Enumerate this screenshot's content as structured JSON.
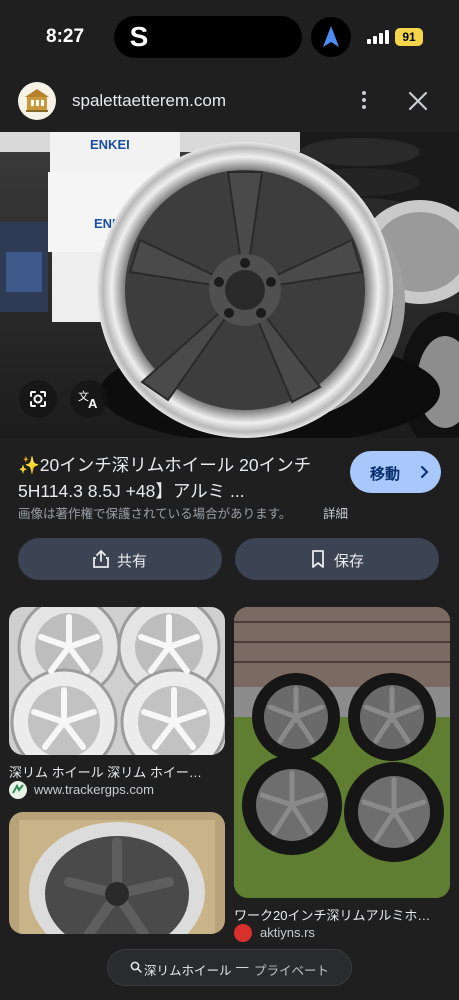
{
  "status_bar": {
    "time": "8:27",
    "app_letter": "S",
    "battery": "91"
  },
  "header": {
    "site": "spalettaetterem.com"
  },
  "hero": {
    "brand_text": "ENKEI"
  },
  "result": {
    "title": "✨20インチ深リムホイール 20インチ 5H114.3 8.5J +48】アルミ ...",
    "visit_label": "移動",
    "copyright_notice": "画像は著作権で保護されている場合があります。",
    "copyright_detail": "詳細"
  },
  "actions": {
    "share_label": "共有",
    "save_label": "保存"
  },
  "related": [
    {
      "title": "深リム ホイール 深リム ホイー…",
      "source": "www.trackergps.com"
    },
    {
      "title": "ワーク20インチ深リムアルミホ…",
      "source": "aktiyns.rs"
    }
  ],
  "bottom_search": {
    "query": "深リムホイール",
    "separator": "—",
    "mode": "プライベート"
  },
  "colors": {
    "background": "#1f1f1f",
    "accent_button": "#a8c7fa",
    "secondary_button": "#3c4352",
    "battery": "#f5d64a"
  },
  "icons": {
    "lens": "google-lens-icon",
    "translate": "translate-icon",
    "share": "share-icon",
    "save": "bookmark-icon",
    "close": "close-icon",
    "more": "more-vert-icon",
    "search": "search-icon",
    "navigation": "navigation-arrow-icon"
  }
}
